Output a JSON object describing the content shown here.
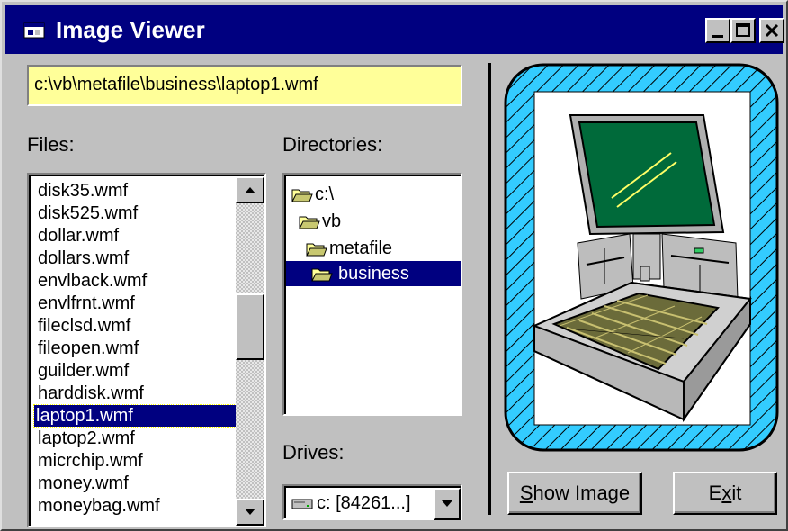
{
  "window": {
    "title": "Image Viewer",
    "icon": "app-window-icon"
  },
  "title_buttons": {
    "minimize": "minimize-icon",
    "maximize": "maximize-icon",
    "close": "close-icon"
  },
  "path": {
    "value": "c:\\vb\\metafile\\business\\laptop1.wmf"
  },
  "files": {
    "label": "Files:",
    "items": [
      "disk35.wmf",
      "disk525.wmf",
      "dollar.wmf",
      "dollars.wmf",
      "envlback.wmf",
      "envlfrnt.wmf",
      "fileclsd.wmf",
      "fileopen.wmf",
      "guilder.wmf",
      "harddisk.wmf",
      "laptop1.wmf",
      "laptop2.wmf",
      "micrchip.wmf",
      "money.wmf",
      "moneybag.wmf"
    ],
    "selected": "laptop1.wmf"
  },
  "directories": {
    "label": "Directories:",
    "items": [
      "c:\\",
      "vb",
      "metafile",
      "business"
    ],
    "selected": "business"
  },
  "drives": {
    "label": "Drives:",
    "value": "c: [84261...]"
  },
  "buttons": {
    "show_image_prefix": "",
    "show_image_accel": "S",
    "show_image_rest": "how Image",
    "exit_prefix": "E",
    "exit_accel": "x",
    "exit_rest": "it"
  },
  "colors": {
    "titlebar": "#000080",
    "path_bg": "#ffff99",
    "frame_hatch": "#33ccff",
    "selection": "#000080"
  },
  "image": {
    "subject": "laptop-computer-image"
  }
}
